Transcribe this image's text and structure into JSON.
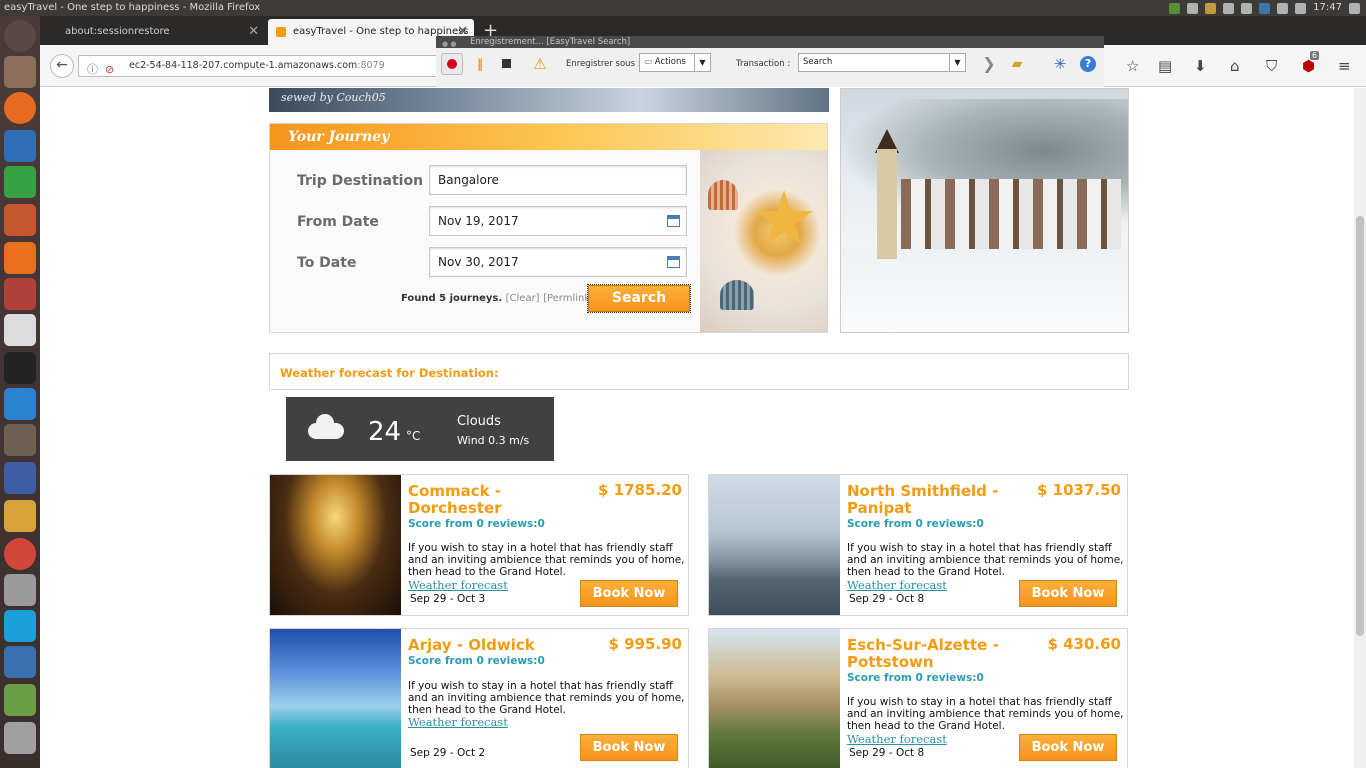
{
  "window_title": "easyTravel - One step to happiness - Mozilla Firefox",
  "system": {
    "clock": "17:47"
  },
  "tabs": [
    {
      "label": "about:sessionrestore"
    },
    {
      "label": "easyTravel - One step to happiness"
    }
  ],
  "url": {
    "host": "ec2-54-84-118-207.compute-1.amazonaws.com",
    "port": ":8079"
  },
  "recorder": {
    "title": "Enregistrement... [EasyTravel Search]",
    "save_as_label": "Enregistrer sous :",
    "save_as_value": "Actions",
    "transaction_label": "Transaction :",
    "transaction_value": "Search"
  },
  "addon_badge": "6",
  "banner_signature": "sewed by Couch05",
  "journey": {
    "heading": "Your Journey",
    "destination_label": "Trip Destination",
    "destination_value": "Bangalore",
    "from_label": "From Date",
    "from_value": "Nov 19, 2017",
    "to_label": "To Date",
    "to_value": "Nov 30, 2017",
    "found_text": "Found 5 journeys.",
    "clear_link": "[Clear]",
    "permalink": "[Permlink]",
    "search_button": "Search"
  },
  "weather": {
    "heading": "Weather forecast for Destination:",
    "temp": "24",
    "unit": "°C",
    "condition": "Clouds",
    "wind": "Wind 0.3 m/s"
  },
  "results": [
    {
      "name": "Commack - Dorchester",
      "price": "$ 1785.20",
      "score": "Score from 0 reviews:0",
      "desc": "If you wish to stay in a hotel that has friendly staff and an inviting ambience that reminds you of home, then head to the Grand Hotel.",
      "weather_link": "Weather forecast",
      "dates": "Sep 29 - Oct 3",
      "book": "Book Now"
    },
    {
      "name": "North Smithfield - Panipat",
      "price": "$ 1037.50",
      "score": "Score from 0 reviews:0",
      "desc": "If you wish to stay in a hotel that has friendly staff and an inviting ambience that reminds you of home, then head to the Grand Hotel.",
      "weather_link": "Weather forecast",
      "dates": "Sep 29 - Oct 8",
      "book": "Book Now"
    },
    {
      "name": "Arjay - Oldwick",
      "price": "$ 995.90",
      "score": "Score from 0 reviews:0",
      "desc": "If you wish to stay in a hotel that has friendly staff and an inviting ambience that reminds you of home, then head to the Grand Hotel.",
      "weather_link": "Weather forecast",
      "dates": "Sep 29 - Oct 2",
      "book": "Book Now"
    },
    {
      "name": "Esch-Sur-Alzette - Pottstown",
      "price": "$ 430.60",
      "score": "Score from 0 reviews:0",
      "desc": "If you wish to stay in a hotel that has friendly staff and an inviting ambience that reminds you of home, then head to the Grand Hotel.",
      "weather_link": "Weather forecast",
      "dates": "Sep 29 - Oct 8",
      "book": "Book Now"
    }
  ],
  "colors": {
    "accent": "#f39c12",
    "link": "#2a9bb5",
    "widget_bg": "#414141"
  }
}
